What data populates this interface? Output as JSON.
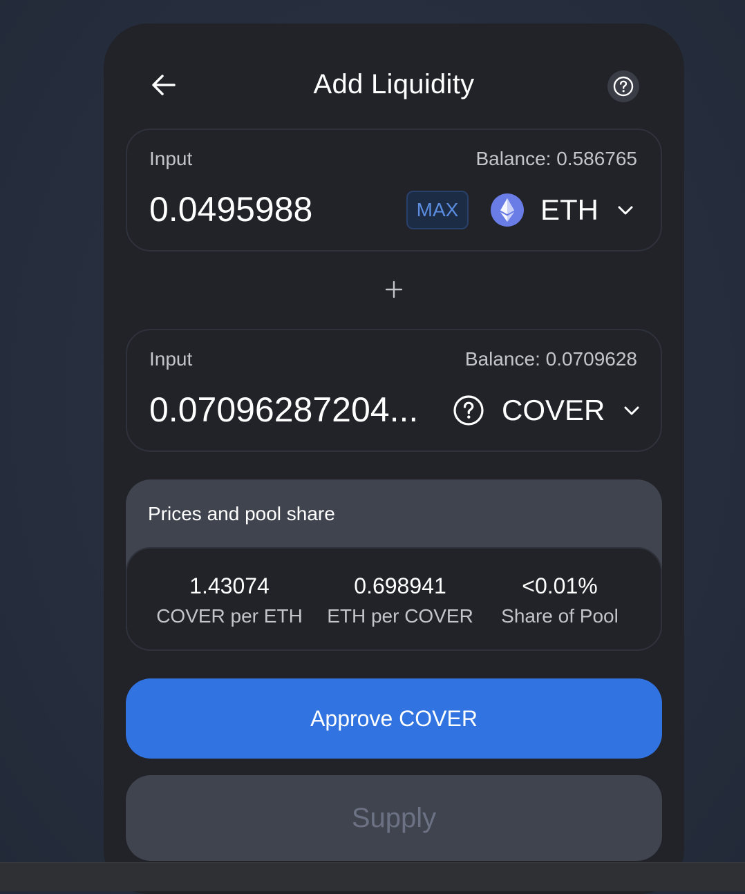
{
  "header": {
    "title": "Add Liquidity",
    "back_icon": "arrow-left-icon",
    "help_icon": "question-circle-icon"
  },
  "input_a": {
    "label": "Input",
    "balance": "Balance: 0.586765",
    "amount": "0.0495988",
    "max_label": "MAX",
    "token": "ETH",
    "token_icon": "ethereum-icon"
  },
  "plus_icon": "plus-icon",
  "input_b": {
    "label": "Input",
    "balance": "Balance: 0.0709628",
    "amount": "0.07096287204...",
    "token": "COVER",
    "token_icon": "question-circle-icon"
  },
  "prices": {
    "title": "Prices and pool share",
    "stats": [
      {
        "value": "1.43074",
        "label": "COVER per ETH"
      },
      {
        "value": "0.698941",
        "label": "ETH per COVER"
      },
      {
        "value": "<0.01%",
        "label": "Share of Pool"
      }
    ]
  },
  "actions": {
    "approve_label": "Approve COVER",
    "supply_label": "Supply"
  },
  "colors": {
    "background": "#283040",
    "card": "#212329",
    "panel_border": "#2f323a",
    "prices_header": "#40444f",
    "primary": "#3173e0",
    "disabled_text": "#6c7284",
    "max_text": "#5a8de0",
    "secondary_text": "#c3c5cb"
  }
}
